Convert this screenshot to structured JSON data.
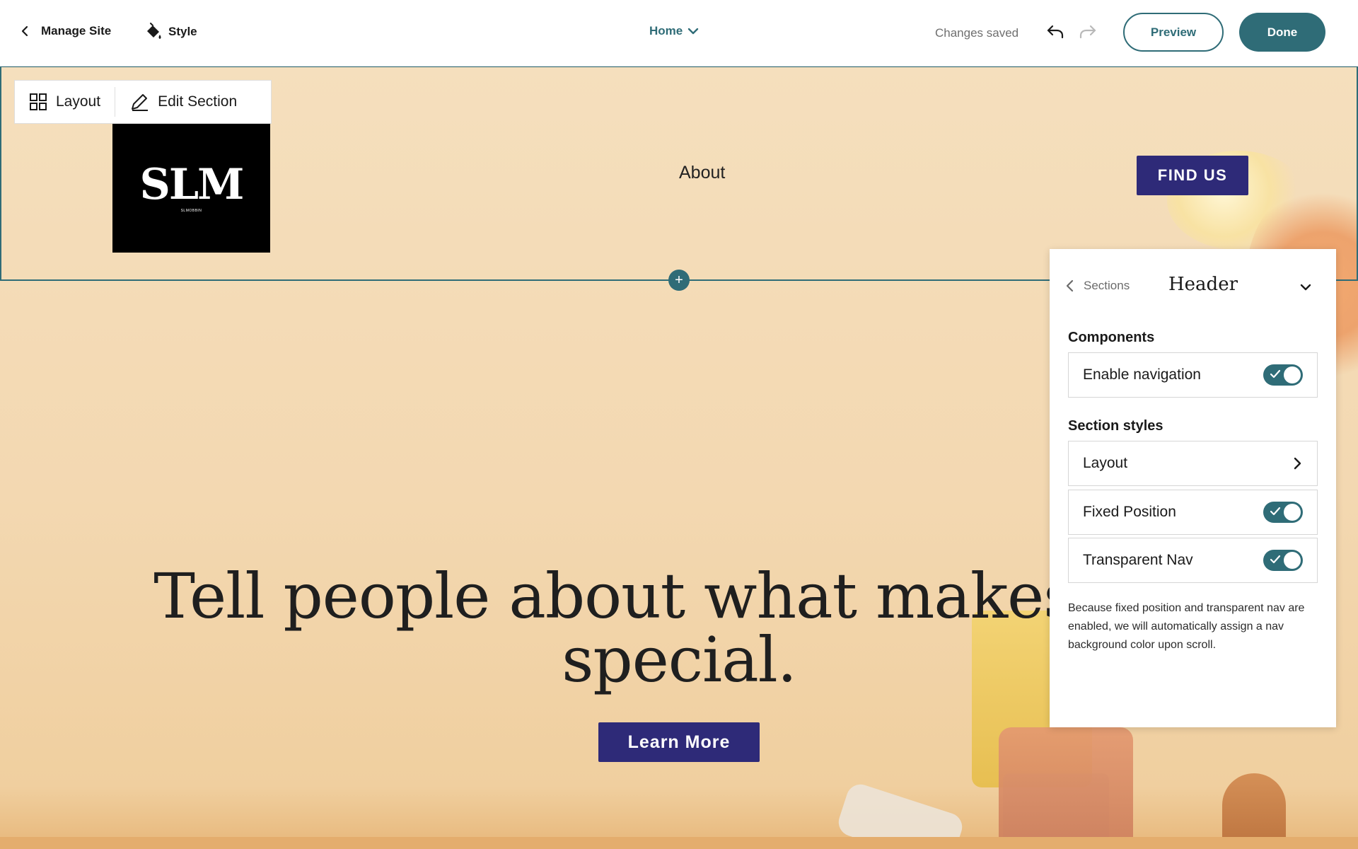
{
  "topbar": {
    "manage_site": "Manage Site",
    "style": "Style",
    "page_selector": "Home",
    "status": "Changes saved",
    "preview": "Preview",
    "done": "Done"
  },
  "section_toolbar": {
    "layout": "Layout",
    "edit_section": "Edit Section"
  },
  "site_header": {
    "logo_text": "SLM",
    "logo_subtext": "SLMOBBIN",
    "nav_items": [
      "About"
    ],
    "cta": "FIND US"
  },
  "hero": {
    "title": "Tell people about what makes you special.",
    "cta": "Learn More"
  },
  "panel": {
    "back_label": "Sections",
    "title": "Header",
    "components_heading": "Components",
    "components": [
      {
        "label": "Enable navigation",
        "enabled": true
      }
    ],
    "styles_heading": "Section styles",
    "styles": [
      {
        "label": "Layout",
        "type": "link"
      },
      {
        "label": "Fixed Position",
        "type": "toggle",
        "enabled": true
      },
      {
        "label": "Transparent Nav",
        "type": "toggle",
        "enabled": true
      }
    ],
    "note": "Because fixed position and transparent nav are enabled, we will automatically assign a nav background color upon scroll."
  },
  "colors": {
    "accent": "#2f6c77",
    "site_button": "#2e2a78",
    "background": "#f3dcb9"
  },
  "icons": [
    "chevron-left-icon",
    "paint-bucket-icon",
    "chevron-down-icon",
    "undo-icon",
    "redo-icon",
    "grid-icon",
    "pencil-icon",
    "plus-icon",
    "chevron-right-icon",
    "check-icon"
  ]
}
